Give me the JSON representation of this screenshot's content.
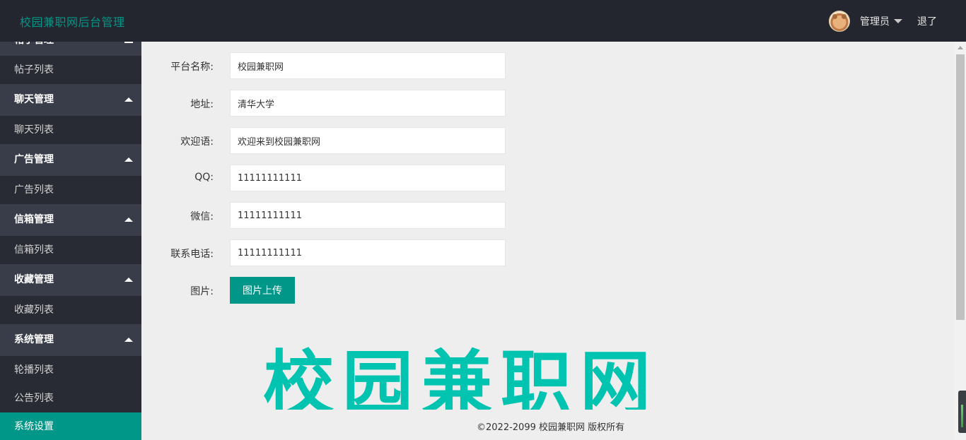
{
  "header": {
    "brand": "校园兼职网后台管理",
    "user_name": "管理员",
    "logout_label": "退了"
  },
  "sidebar": {
    "partial_group": "帖子管理",
    "items": [
      {
        "type": "item",
        "label": "帖子列表"
      },
      {
        "type": "group",
        "label": "聊天管理"
      },
      {
        "type": "item",
        "label": "聊天列表"
      },
      {
        "type": "group",
        "label": "广告管理"
      },
      {
        "type": "item",
        "label": "广告列表"
      },
      {
        "type": "group",
        "label": "信箱管理"
      },
      {
        "type": "item",
        "label": "信箱列表"
      },
      {
        "type": "group",
        "label": "收藏管理"
      },
      {
        "type": "item",
        "label": "收藏列表"
      },
      {
        "type": "group",
        "label": "系统管理"
      },
      {
        "type": "item",
        "label": "轮播列表"
      },
      {
        "type": "item",
        "label": "公告列表"
      },
      {
        "type": "item",
        "label": "系统设置",
        "active": true
      }
    ]
  },
  "form": {
    "platform_name": {
      "label": "平台名称:",
      "value": "校园兼职网"
    },
    "address": {
      "label": "地址:",
      "value": "清华大学"
    },
    "welcome": {
      "label": "欢迎语:",
      "value": "欢迎来到校园兼职网"
    },
    "qq": {
      "label": "QQ:",
      "value": "11111111111"
    },
    "wechat": {
      "label": "微信:",
      "value": "11111111111"
    },
    "phone": {
      "label": "联系电话:",
      "value": "11111111111"
    },
    "image": {
      "label": "图片:",
      "button_label": "图片上传"
    }
  },
  "logo_text": "校园兼职网",
  "footer": "©2022-2099 校园兼职网 版权所有",
  "colors": {
    "accent": "#009688",
    "header_bg": "#23262e",
    "sidebar_bg": "#282b33",
    "sidebar_group_bg": "#393d49",
    "logo": "#00c4b0"
  }
}
